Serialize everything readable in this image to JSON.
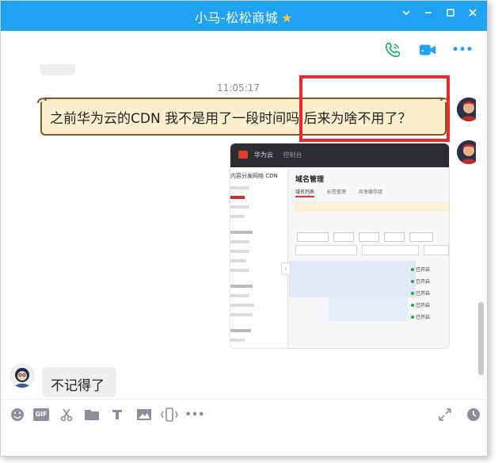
{
  "window": {
    "title": "小马-松松商城",
    "colors": {
      "titlebar": "#1ea2f1",
      "highlight": "#ea2a2a"
    }
  },
  "chat": {
    "timestamp": "11:05:17",
    "messages": [
      {
        "side": "right",
        "type": "text",
        "style": "scroll",
        "text": "之前华为云的CDN 我不是用了一段时间吗 后来为啥不用了？"
      },
      {
        "side": "right",
        "type": "image",
        "alt": "华为云 CDN 控制台截图"
      },
      {
        "side": "left",
        "type": "text",
        "text": "不记得了"
      }
    ]
  },
  "screenshot": {
    "brand": "华为云",
    "console": "控制台",
    "sidebar_title": "内容分发网络 CDN",
    "main_title": "域名管理",
    "tabs": [
      "域名列表",
      "标签管理",
      "共享缓存组"
    ],
    "status_items": [
      "已开启",
      "已开启",
      "已开启",
      "已开启",
      "已开启"
    ]
  },
  "top_actions": {
    "call_icon": "phone-icon",
    "video_icon": "video-icon",
    "more_label": "•••"
  },
  "bottom_tools": [
    "emoji-icon",
    "gif-icon",
    "scissors-icon",
    "folder-icon",
    "music-icon",
    "image-icon",
    "shake-icon",
    "more-icon",
    "expand-icon",
    "history-icon"
  ],
  "bottom": {
    "gif_label": "GIF",
    "more_label": "•••"
  }
}
